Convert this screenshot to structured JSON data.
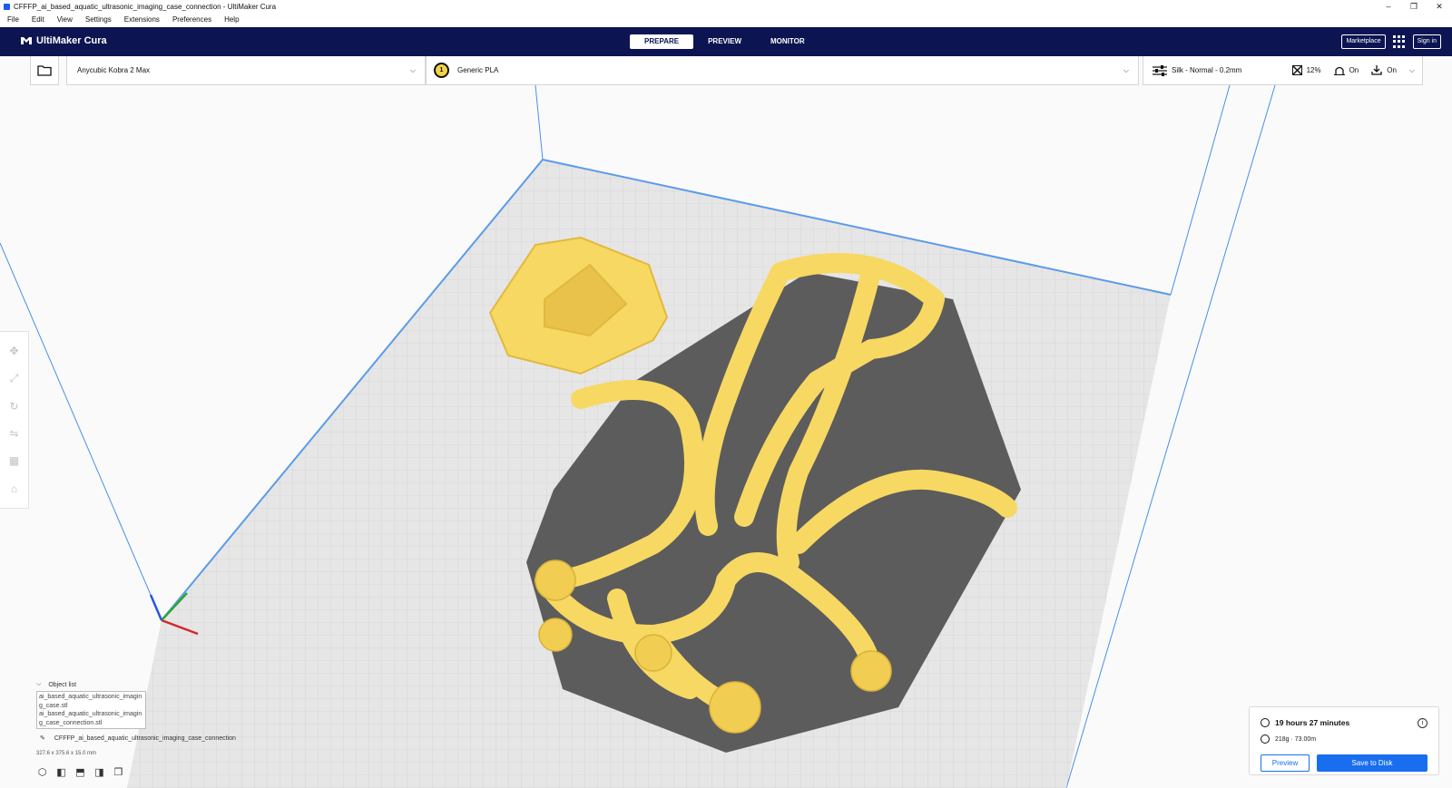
{
  "window": {
    "title": "CFFFP_ai_based_aquatic_ultrasonic_imaging_case_connection - UltiMaker Cura",
    "controls": [
      "–",
      "❐",
      "✕"
    ]
  },
  "menu": [
    "File",
    "Edit",
    "View",
    "Settings",
    "Extensions",
    "Preferences",
    "Help"
  ],
  "header": {
    "brand": "UltiMaker Cura",
    "stages": [
      "PREPARE",
      "PREVIEW",
      "MONITOR"
    ],
    "active_stage": "PREPARE",
    "marketplace": "Marketplace",
    "signin": "Sign in"
  },
  "config": {
    "printer": "Anycubic Kobra 2 Max",
    "extruder_number": "1",
    "material": "Generic PLA",
    "profile": "Silk - Normal - 0.2mm",
    "infill": "12%",
    "support": "On",
    "adhesion": "On"
  },
  "object_list": {
    "header": "Object list",
    "items": [
      "ai_based_aquatic_ultrasonic_imagin\ng_case.stl",
      "ai_based_aquatic_ultrasonic_imagin\ng_case_connection.stl"
    ]
  },
  "job": {
    "name": "CFFFP_ai_based_aquatic_ultrasonic_imaging_case_connection",
    "dimensions": "327.6 x 375.6 x 15.0 mm"
  },
  "output": {
    "time": "19 hours 27 minutes",
    "material_usage": "218g · 73.00m",
    "preview_button": "Preview",
    "save_button": "Save to Disk"
  },
  "colors": {
    "header_bg": "#0c1552",
    "accent_blue": "#196ef0",
    "model_yellow": "#f7d862",
    "shadow_gray": "#5c5c5c",
    "plate_gray": "#e4e4e4"
  }
}
